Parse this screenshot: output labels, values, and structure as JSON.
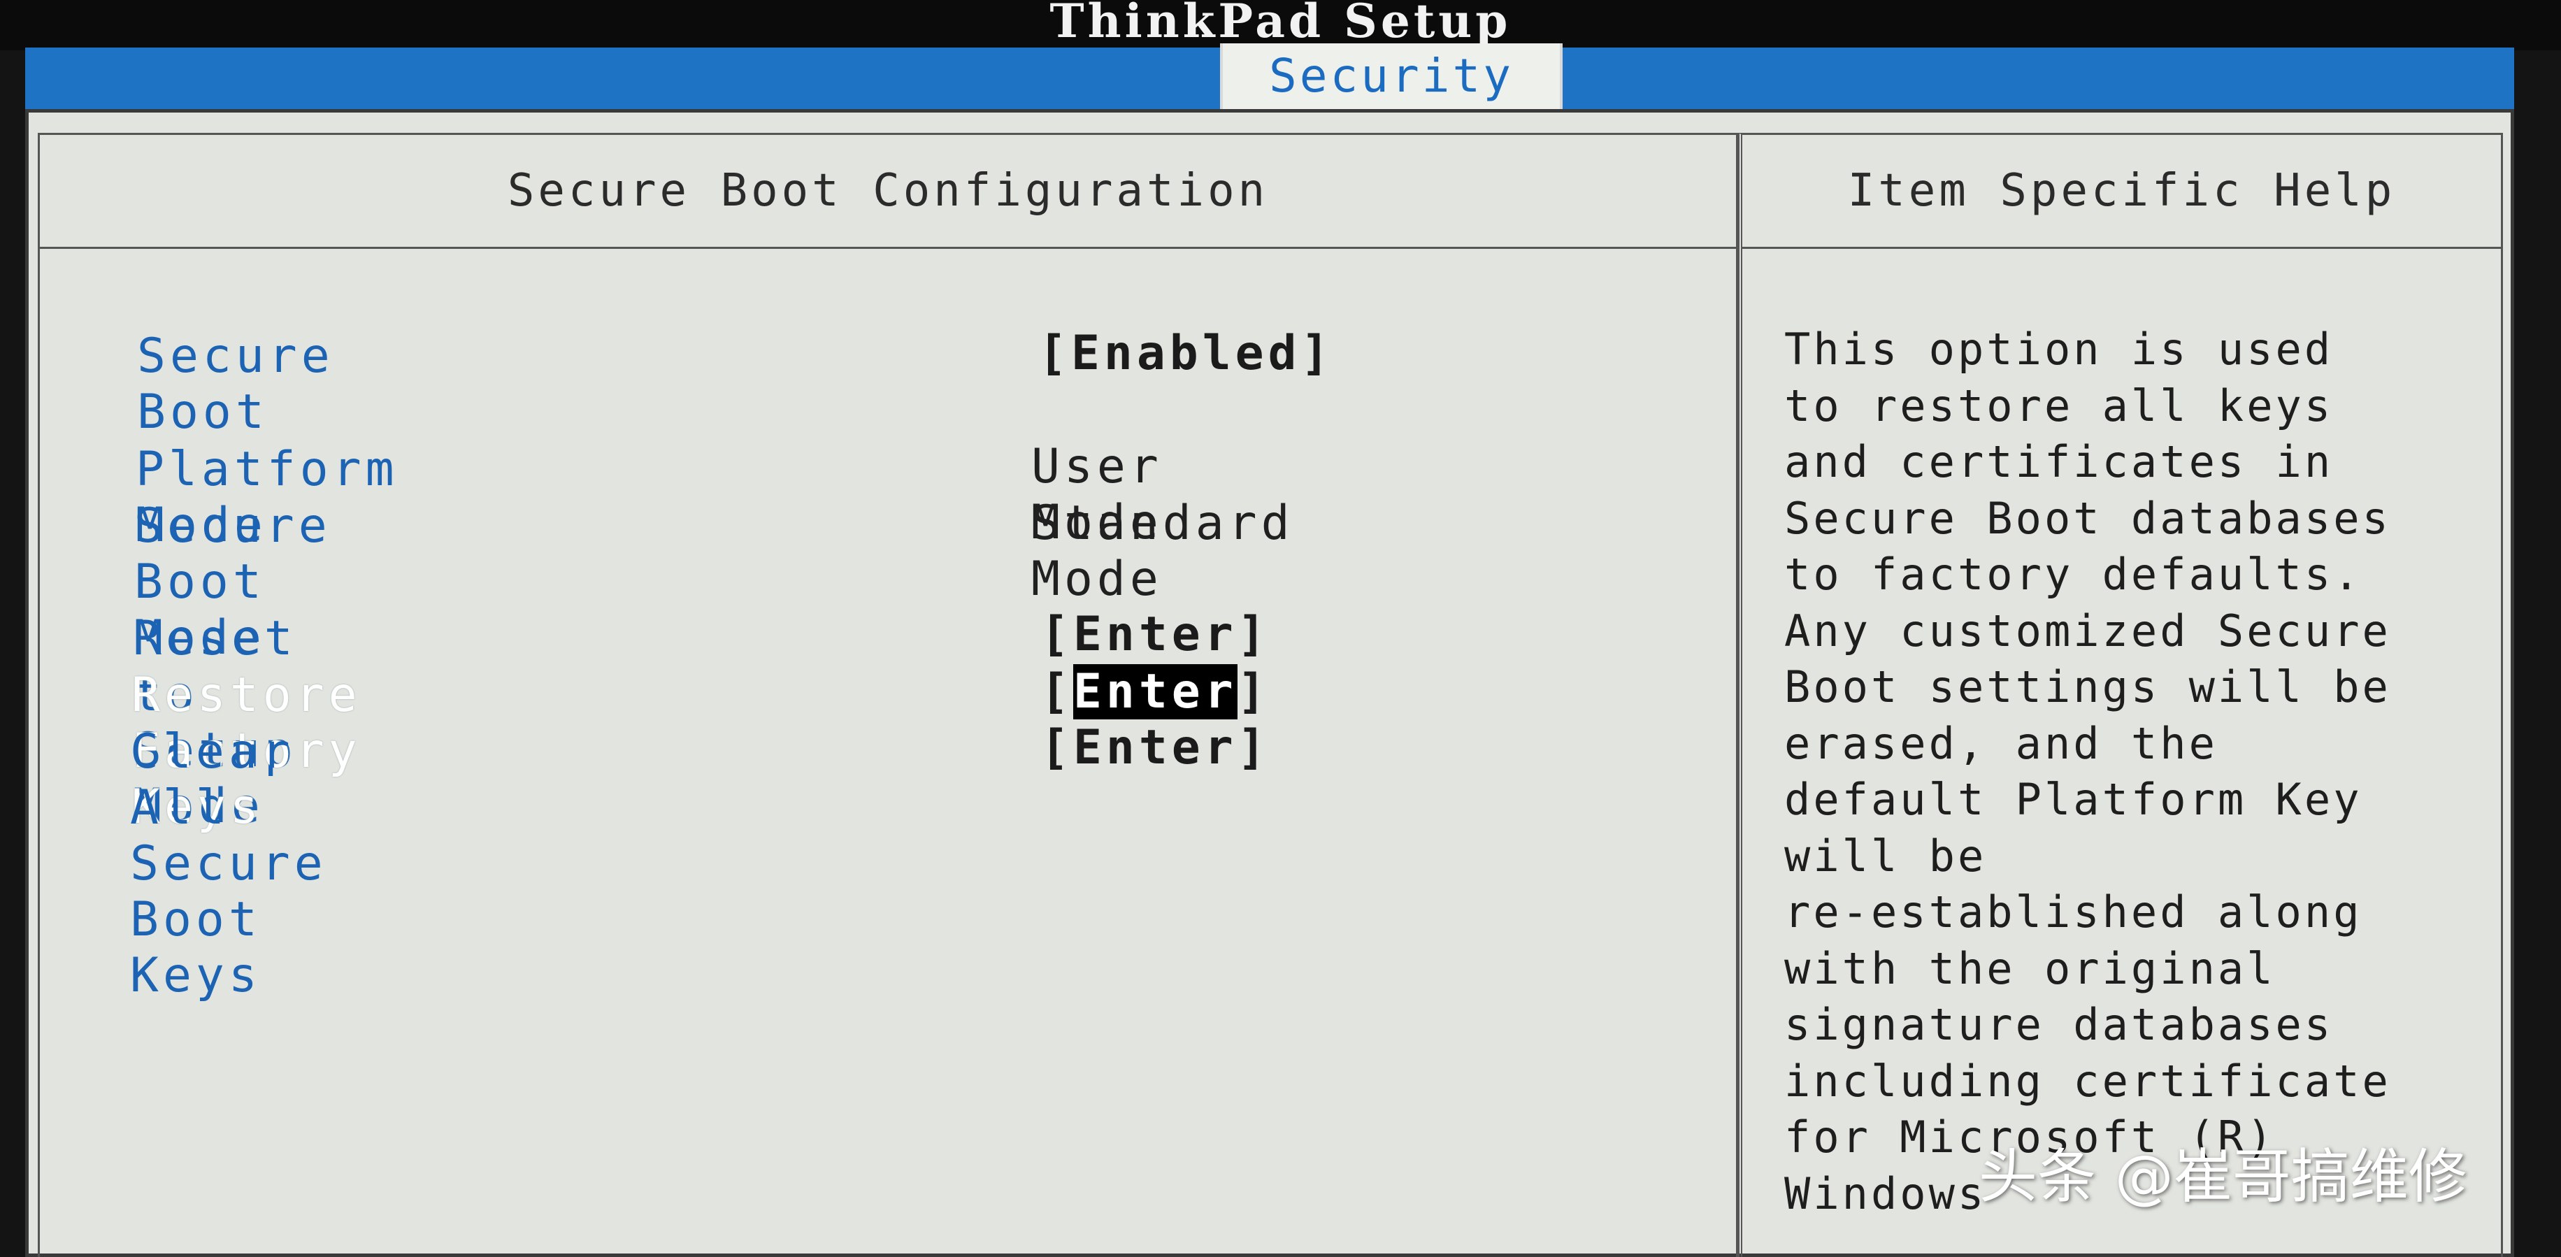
{
  "app": {
    "title": "ThinkPad Setup"
  },
  "tabs": {
    "active_label": "Security"
  },
  "main": {
    "header": "Secure Boot Configuration",
    "settings": [
      {
        "label": "Secure Boot",
        "value": "[Enabled]"
      },
      {
        "label": "Platform Mode",
        "value": "User Mode"
      },
      {
        "label": "Secure Boot Mode",
        "value": "Standard Mode"
      },
      {
        "label": "Reset to Setup Mode",
        "value": "[Enter]"
      },
      {
        "label": "Restore Factory Keys",
        "value_open": "[",
        "value_inner": "Enter",
        "value_close": "]"
      },
      {
        "label": "Clear All Secure Boot Keys",
        "value": "[Enter]"
      }
    ]
  },
  "help": {
    "header": "Item Specific Help",
    "lines": [
      "This option is used",
      "to restore all keys",
      "and certificates in",
      "Secure Boot databases",
      "to factory defaults.",
      "Any customized Secure",
      "Boot settings will be",
      "erased, and the",
      "default Platform Key",
      "will be",
      "re-established along",
      "with the original",
      "signature databases",
      "including certificate",
      "for Microsoft (R)",
      "Windows"
    ]
  },
  "watermark": {
    "text": "头条 @崔哥搞维修"
  },
  "colors": {
    "accent_blue": "#1f73c4",
    "label_blue": "#1d63b3",
    "screen_bg": "#e1e4df",
    "selected_label": "#ffffff"
  }
}
